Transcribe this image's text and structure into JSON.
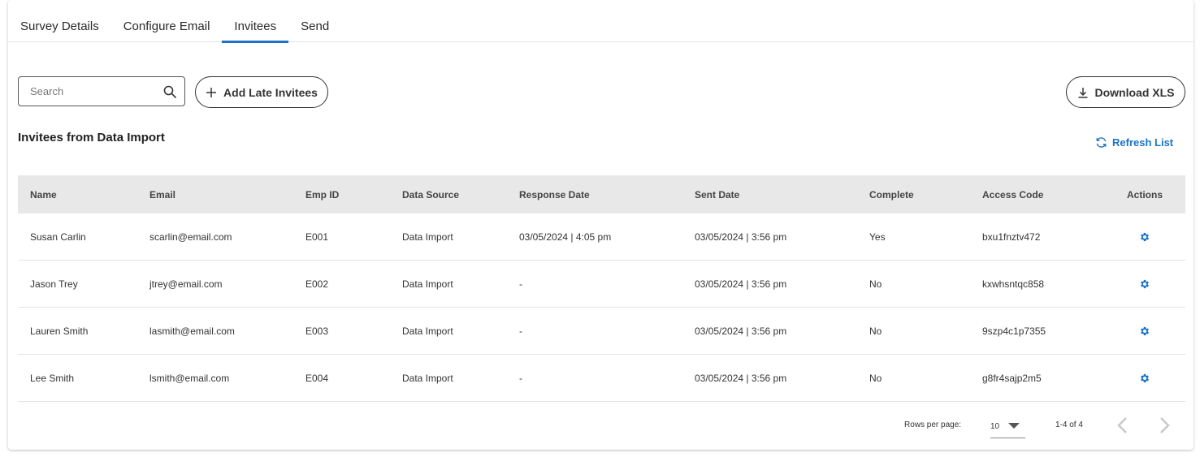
{
  "tabs": [
    {
      "label": "Survey Details"
    },
    {
      "label": "Configure Email"
    },
    {
      "label": "Invitees"
    },
    {
      "label": "Send"
    }
  ],
  "active_tab": "Invitees",
  "search": {
    "placeholder": "Search",
    "value": ""
  },
  "toolbar": {
    "add_label": "Add Late Invitees",
    "download_label": "Download XLS",
    "refresh_label": "Refresh List"
  },
  "section_title": "Invitees from Data Import",
  "table": {
    "headers": [
      "Name",
      "Email",
      "Emp ID",
      "Data Source",
      "Response Date",
      "Sent Date",
      "Complete",
      "Access Code",
      "Actions"
    ],
    "rows": [
      [
        "Susan Carlin",
        "scarlin@email.com",
        "E001",
        "Data Import",
        "03/05/2024 | 4:05 pm",
        "03/05/2024 | 3:56 pm",
        "Yes",
        "bxu1fnztv472"
      ],
      [
        "Jason Trey",
        "jtrey@email.com",
        "E002",
        "Data Import",
        "-",
        "03/05/2024 | 3:56 pm",
        "No",
        "kxwhsntqc858"
      ],
      [
        "Lauren Smith",
        "lasmith@email.com",
        "E003",
        "Data Import",
        "-",
        "03/05/2024 | 3:56 pm",
        "No",
        "9szp4c1p7355"
      ],
      [
        "Lee Smith",
        "lsmith@email.com",
        "E004",
        "Data Import",
        "-",
        "03/05/2024 | 3:56 pm",
        "No",
        "g8fr4sajp2m5"
      ]
    ]
  },
  "pagination": {
    "rows_per_page_label": "Rows per page:",
    "rows_per_page": "10",
    "range": "1-4 of 4"
  },
  "colors": {
    "accent": "#1a73c9",
    "header_bg": "#e8e8e8"
  }
}
